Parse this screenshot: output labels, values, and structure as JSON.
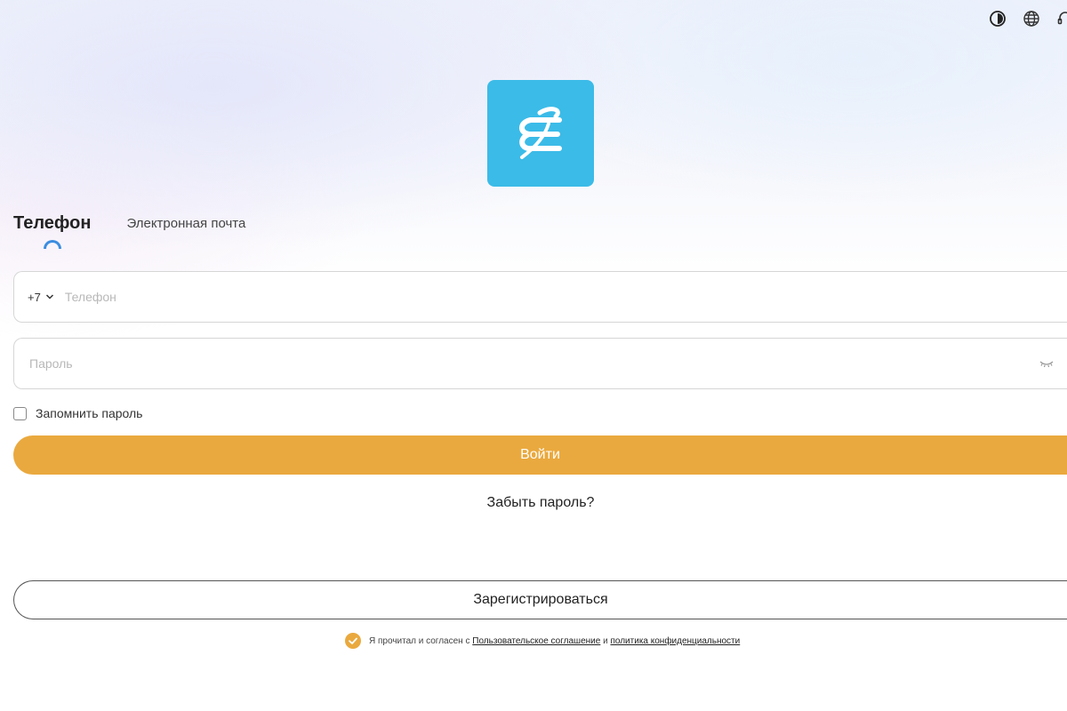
{
  "toolbar": {
    "icons": [
      "contrast-icon",
      "globe-icon",
      "headset-icon"
    ]
  },
  "brand": {
    "logo_color": "#3bbbe8"
  },
  "tabs": {
    "phone_label": "Телефон",
    "email_label": "Электронная почта",
    "active": "phone"
  },
  "phone_field": {
    "country_code": "+7",
    "value": "",
    "placeholder": "Телефон"
  },
  "password_field": {
    "value": "",
    "placeholder": "Пароль"
  },
  "remember": {
    "label": "Запомнить пароль",
    "checked": false
  },
  "login": {
    "label": "Войти",
    "color": "#eaa93e"
  },
  "forgot": {
    "label": "Забыть пароль?"
  },
  "register": {
    "label": "Зарегистрироваться"
  },
  "agreement": {
    "checked": true,
    "prefix": "Я прочитал и согласен с",
    "terms_link": "Пользовательское соглашение",
    "conjunction": "и",
    "privacy_link": "политика конфиденциальности"
  }
}
